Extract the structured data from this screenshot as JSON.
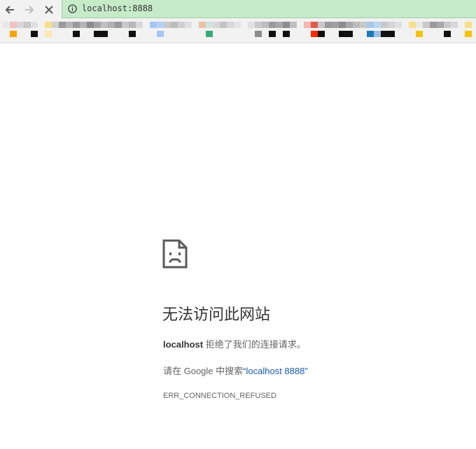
{
  "toolbar": {
    "back_icon": "arrow-left-icon",
    "forward_icon": "arrow-right-icon",
    "stop_icon": "close-icon",
    "info_icon": "info-icon",
    "url": "localhost:8888",
    "colors": {
      "omnibox_bg": "#c6ebc9",
      "toolbar_bg": "#f2f2f2"
    }
  },
  "error": {
    "icon": "sad-page-icon",
    "title": "无法访问此网站",
    "host": "localhost",
    "message": " 拒绝了我们的连接请求。",
    "search_prefix": "请在 Google 中搜索",
    "search_link": "“localhost 8888”",
    "code": "ERR_CONNECTION_REFUSED",
    "colors": {
      "link": "#1a5ab3",
      "text": "#646464",
      "title": "#333333"
    }
  }
}
